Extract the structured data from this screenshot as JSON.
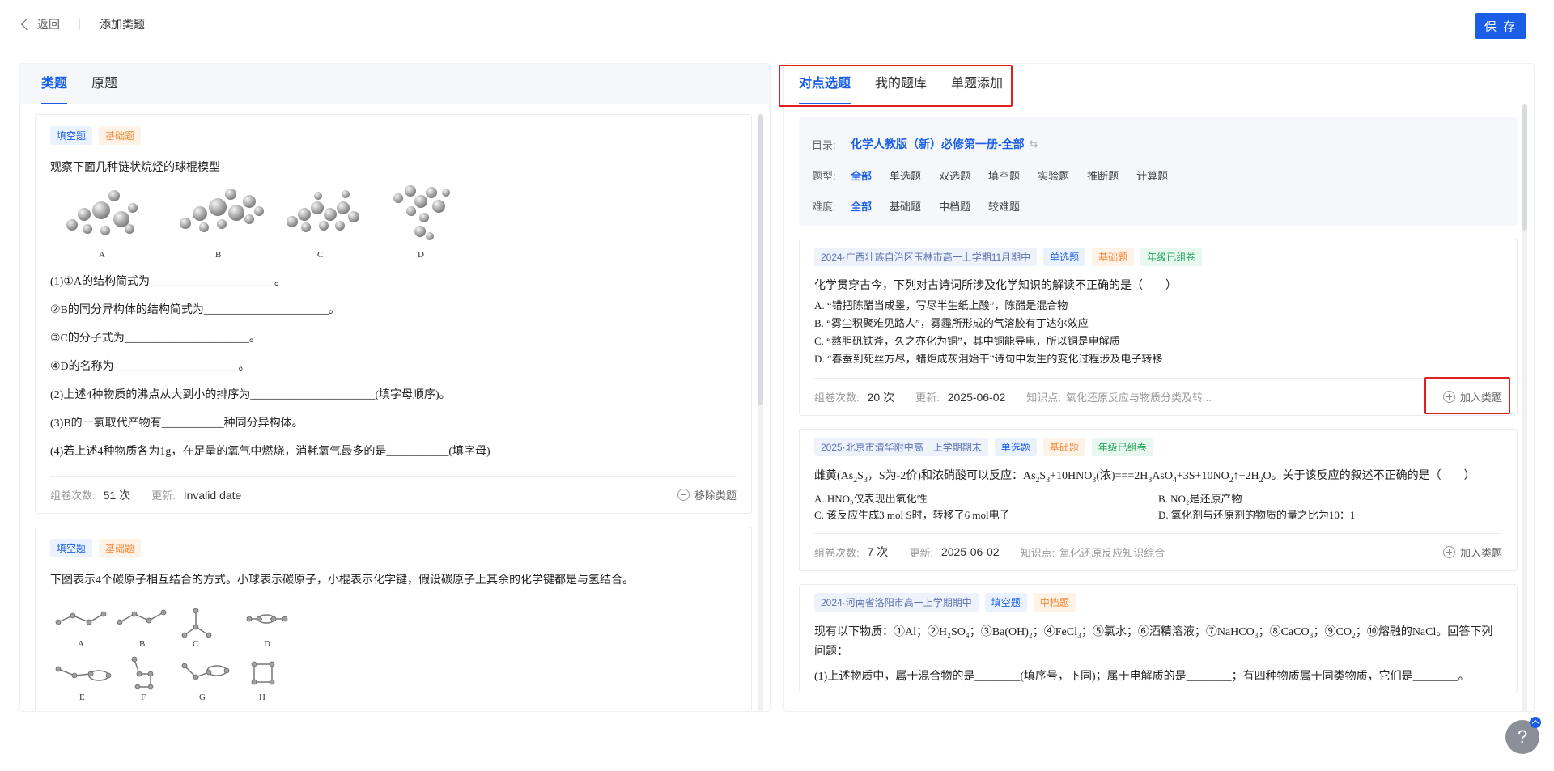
{
  "header": {
    "back_label": "返回",
    "title": "添加类题",
    "save_label": "保 存"
  },
  "left": {
    "tabs": [
      {
        "label": "类题"
      },
      {
        "label": "原题"
      }
    ],
    "cards": [
      {
        "tags": [
          "填空题",
          "基础题"
        ],
        "stem": "观察下面几种链状烷烃的球棍模型",
        "figure_labels": [
          "A",
          "B",
          "C",
          "D"
        ],
        "lines": [
          "(1)①A的结构简式为______________________。",
          "②B的同分异构体的结构简式为______________________。",
          "③C的分子式为______________________。",
          "④D的名称为______________________。",
          "(2)上述4种物质的沸点从大到小的排序为______________________(填字母顺序)。",
          "(3)B的一氯取代产物有___________种同分异构体。",
          "(4)若上述4种物质各为1g，在足量的氧气中燃烧，消耗氧气最多的是___________(填字母)"
        ],
        "foot": {
          "count_label": "组卷次数:",
          "count_value": "51 次",
          "update_label": "更新:",
          "update_value": "Invalid date",
          "action_label": "移除类题"
        }
      },
      {
        "tags": [
          "填空题",
          "基础题"
        ],
        "stem": "下图表示4个碳原子相互结合的方式。小球表示碳原子，小棍表示化学键，假设碳原子上其余的化学键都是与氢结合。",
        "figure_labels": [
          "A",
          "B",
          "C",
          "D",
          "E",
          "F",
          "G",
          "H"
        ]
      }
    ]
  },
  "right": {
    "tabs": [
      {
        "label": "对点选题"
      },
      {
        "label": "我的题库"
      },
      {
        "label": "单题添加"
      }
    ],
    "filter": {
      "catalog_label": "目录:",
      "catalog_value": "化学人教版（新）必修第一册-全部",
      "type_label": "题型:",
      "types": [
        "全部",
        "单选题",
        "双选题",
        "填空题",
        "实验题",
        "推断题",
        "计算题"
      ],
      "difficulty_label": "难度:",
      "difficulties": [
        "全部",
        "基础题",
        "中档题",
        "较难题"
      ]
    },
    "cards": [
      {
        "tags": [
          "2024·广西壮族自治区玉林市高一上学期11月期中",
          "单选题",
          "基础题",
          "年级已组卷"
        ],
        "stem": "化学贯穿古今，下列对古诗词所涉及化学知识的解读不正确的是（　　）",
        "options": [
          "A. “错把陈醋当成墨，写尽半生纸上酸”，陈醋是混合物",
          "B. “雾尘积聚难见路人”，雾霾所形成的气溶胶有丁达尔效应",
          "C. “熬胆矾铁斧，久之亦化为铜”，其中铜能导电，所以铜是电解质",
          "D. “春蚕到死丝方尽，蜡炬成灰泪始干”诗句中发生的变化过程涉及电子转移"
        ],
        "foot": {
          "count_label": "组卷次数:",
          "count_value": "20 次",
          "update_label": "更新:",
          "update_value": "2025-06-02",
          "kp_label": "知识点:",
          "kp_value": "氧化还原反应与物质分类及转...",
          "action_label": "加入类题"
        }
      },
      {
        "tags": [
          "2025·北京市清华附中高一上学期期末",
          "单选题",
          "基础题",
          "年级已组卷"
        ],
        "stem_parts": [
          "雌黄(As",
          "2",
          "S",
          "3",
          "，S为-2价)和浓硝酸可以反应：As",
          "2",
          "S",
          "3",
          "+10HNO",
          "3",
          "(浓)===2H",
          "3",
          "AsO",
          "4",
          "+3S+10NO",
          "2",
          "↑+2H",
          "2",
          "O。关于该反应的叙述不正确的是（　　）"
        ],
        "options": [
          "A. HNO₃仅表现出氧化性",
          "B. NO₂是还原产物",
          "C. 该反应生成3 mol S时，转移了6 mol电子",
          "D. 氧化剂与还原剂的物质的量之比为10：1"
        ],
        "foot": {
          "count_label": "组卷次数:",
          "count_value": "7 次",
          "update_label": "更新:",
          "update_value": "2025-06-02",
          "kp_label": "知识点:",
          "kp_value": "氧化还原反应知识综合",
          "action_label": "加入类题"
        }
      },
      {
        "tags": [
          "2024·河南省洛阳市高一上学期期中",
          "填空题",
          "中档题"
        ],
        "stem": "现有以下物质：①Al；②H₂SO₄；③Ba(OH)₂；④FeCl₃；⑤氯水；⑥酒精溶液；⑦NaHCO₃；⑧CaCO₃；⑨CO₂；⑩熔融的NaCl。回答下列问题：",
        "line1": "(1)上述物质中，属于混合物的是________(填序号，下同)；属于电解质的是________；有四种物质属于同类物质，它们是________。"
      }
    ]
  },
  "help_label": "?"
}
